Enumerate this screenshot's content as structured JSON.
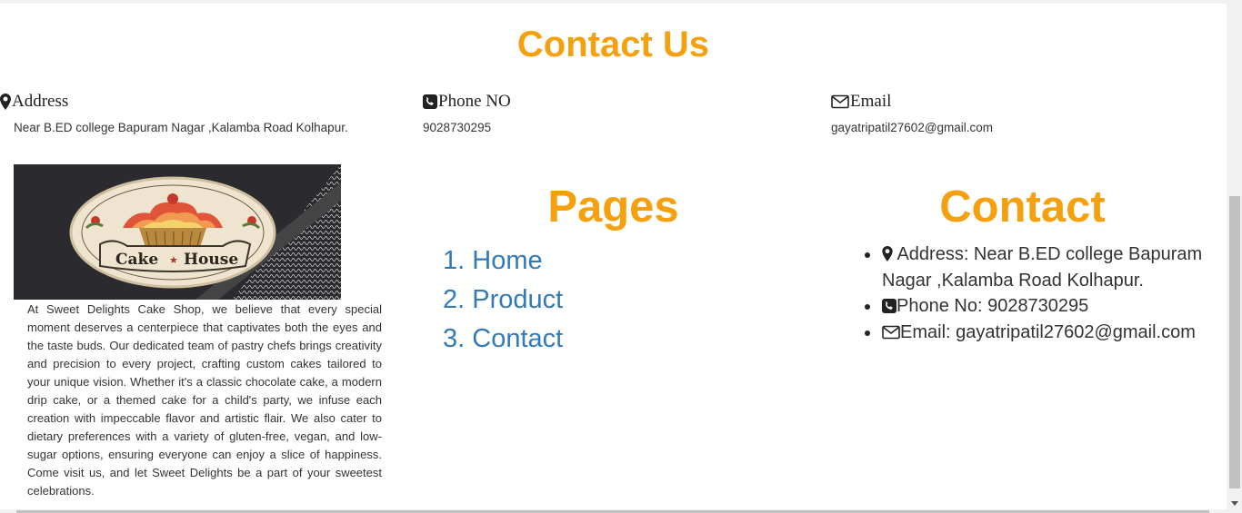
{
  "contact_section": {
    "heading": "Contact Us",
    "address": {
      "label": "Address",
      "value": "Near B.ED college Bapuram Nagar ,Kalamba Road Kolhapur."
    },
    "phone": {
      "label": "Phone NO",
      "value": "9028730295"
    },
    "email": {
      "label": "Email",
      "value": "gayatripatil27602@gmail.com"
    }
  },
  "logo": {
    "text_left": "Cake",
    "text_right": "House",
    "separator": "★"
  },
  "about": {
    "text": "At Sweet Delights Cake Shop, we believe that every special moment deserves a centerpiece that captivates both the eyes and the taste buds. Our dedicated team of pastry chefs brings creativity and precision to every project, crafting custom cakes tailored to your unique vision. Whether it's a classic chocolate cake, a modern drip cake, or a themed cake for a child's party, we infuse each creation with impeccable flavor and artistic flair. We also cater to dietary preferences with a variety of gluten-free, vegan, and low-sugar options, ensuring everyone can enjoy a slice of happiness. Come visit us, and let Sweet Delights be a part of your sweetest celebrations."
  },
  "pages": {
    "heading": "Pages",
    "items": [
      {
        "number": "1.",
        "label": "Home"
      },
      {
        "number": "2.",
        "label": "Product"
      },
      {
        "number": "3.",
        "label": "Contact"
      }
    ]
  },
  "contact_footer": {
    "heading": "Contact",
    "address": "Address: Near B.ED college Bapuram Nagar ,Kalamba Road Kolhapur.",
    "phone": "Phone No: 9028730295",
    "email": "Email: gayatripatil27602@gmail.com"
  },
  "colors": {
    "accent": "#f5a00f",
    "link": "#337ab7",
    "text": "#333333"
  },
  "icons": [
    "map-marker-icon",
    "phone-square-icon",
    "envelope-icon"
  ]
}
